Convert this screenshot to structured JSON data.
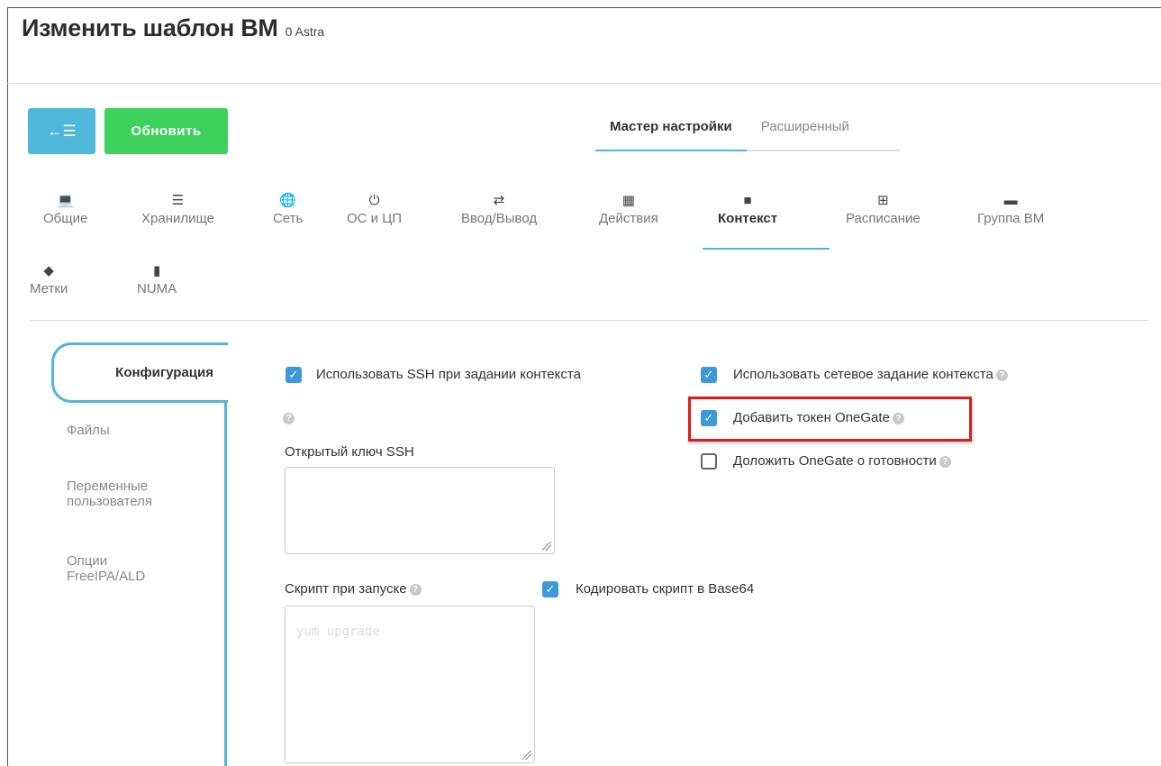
{
  "header": {
    "title": "Изменить шаблон ВМ",
    "subtitle": "0 Astra"
  },
  "toolbar": {
    "back_label": "←☰",
    "update_label": "Обновить"
  },
  "modes": [
    {
      "label": "Мастер настройки"
    },
    {
      "label": "Расширенный"
    }
  ],
  "tabs": [
    {
      "label": "Общие",
      "icon": "💻"
    },
    {
      "label": "Хранилище",
      "icon": "☰"
    },
    {
      "label": "Сеть",
      "icon": "🌐"
    },
    {
      "label": "ОС и ЦП",
      "icon": "⏻"
    },
    {
      "label": "Ввод/Вывод",
      "icon": "⇄"
    },
    {
      "label": "Действия",
      "icon": "▦"
    },
    {
      "label": "Контекст",
      "icon": "■"
    },
    {
      "label": "Расписание",
      "icon": "⊞"
    },
    {
      "label": "Группа ВМ",
      "icon": "▬"
    },
    {
      "label": "Метки",
      "icon": "◆"
    },
    {
      "label": "NUMA",
      "icon": "▮"
    }
  ],
  "subnav": {
    "active": "Конфигурация",
    "items": [
      {
        "label": "Файлы"
      },
      {
        "label": "Переменные пользователя"
      },
      {
        "label": "Опции FreeIPA/ALD"
      }
    ]
  },
  "context": {
    "use_ssh": {
      "label": "Использовать SSH при задании контекста",
      "checked": true
    },
    "network": {
      "label": "Использовать сетевое задание контекста",
      "checked": true
    },
    "onegate_token": {
      "label": "Добавить токен OneGate",
      "checked": true
    },
    "report_ready": {
      "label": "Доложить OneGate о готовности",
      "checked": false
    },
    "ssh_key_label": "Открытый ключ SSH",
    "start_script_label": "Скрипт при запуске",
    "encode_base64": {
      "label": "Кодировать скрипт в Base64",
      "checked": true
    },
    "start_script_placeholder": "yum upgrade"
  },
  "colors": {
    "accent": "#4fb8d8",
    "update_button": "#3ed25c",
    "checkbox": "#3e99d9",
    "highlight": "#e01b1b"
  }
}
